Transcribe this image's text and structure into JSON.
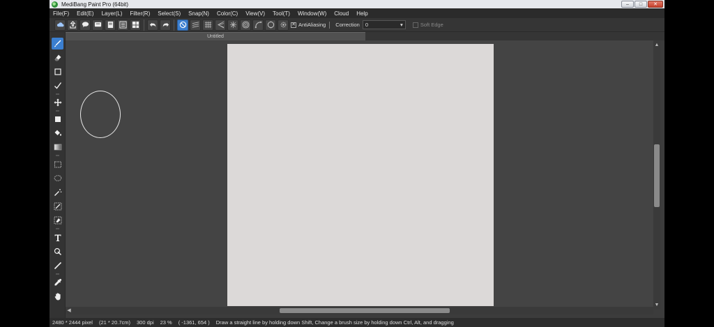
{
  "window": {
    "title": "MediBang Paint Pro (64bit)",
    "controls": {
      "minimize": "–",
      "maximize": "□",
      "close": "✕"
    }
  },
  "menu": [
    "File(F)",
    "Edit(E)",
    "Layer(L)",
    "Filter(R)",
    "Select(S)",
    "Snap(N)",
    "Color(C)",
    "View(V)",
    "Tool(T)",
    "Window(W)",
    "Cloud",
    "Help"
  ],
  "toolbar": {
    "antialiasing_label": "AntiAliasing",
    "antialiasing_checked": "✕",
    "correction_label": "Correction",
    "correction_value": "0",
    "soft_edge_label": "Soft Edge"
  },
  "document": {
    "tab_title": "Untitled"
  },
  "statusbar": {
    "size_pixels": "2480 * 2444 pixel",
    "size_cm": "(21 * 20.7cm)",
    "dpi": "300 dpi",
    "zoom": "23 %",
    "cursor": "( -1361, 654 )",
    "hint": "Draw a straight line by holding down Shift, Change a brush size by holding down Ctrl, Alt, and dragging"
  },
  "colors": {
    "accent": "#3b7fd0",
    "canvas_bg": "#444444",
    "paper": "#dcd9d8"
  }
}
